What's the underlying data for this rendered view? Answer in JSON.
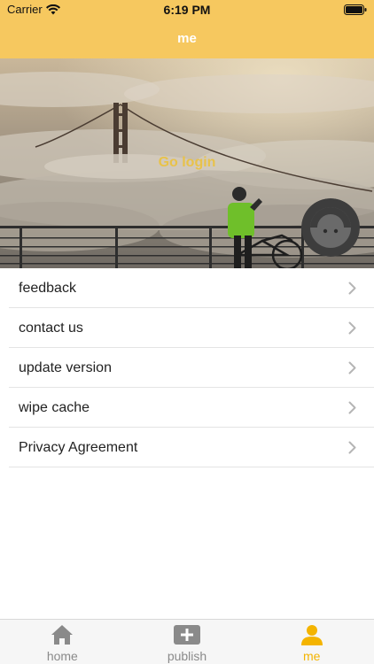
{
  "status_bar": {
    "carrier": "Carrier",
    "time": "6:19 PM"
  },
  "nav": {
    "title": "me"
  },
  "hero": {
    "login_label": "Go login"
  },
  "menu": {
    "items": [
      {
        "label": "feedback"
      },
      {
        "label": "contact us"
      },
      {
        "label": "update version"
      },
      {
        "label": "wipe cache"
      },
      {
        "label": "Privacy Agreement"
      }
    ]
  },
  "tabs": [
    {
      "label": "home",
      "icon": "home-icon",
      "active": false
    },
    {
      "label": "publish",
      "icon": "plus-square-icon",
      "active": false
    },
    {
      "label": "me",
      "icon": "person-icon",
      "active": true
    }
  ],
  "colors": {
    "accent": "#f6c85f",
    "active_tab": "#f4b400",
    "login_text": "#e8c24a",
    "inactive_tab": "#8a8a8a"
  }
}
